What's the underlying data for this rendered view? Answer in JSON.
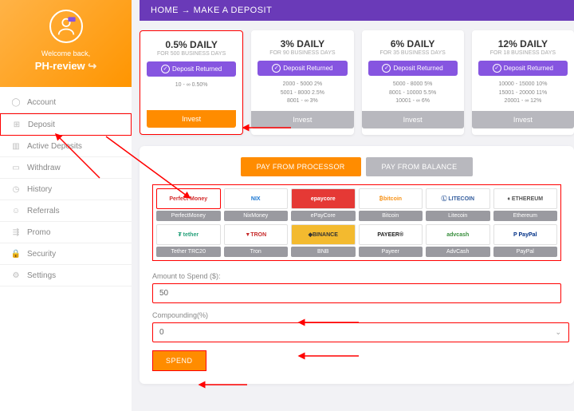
{
  "breadcrumb": {
    "home": "HOME",
    "sep": "→",
    "page": "MAKE A DEPOSIT"
  },
  "profile": {
    "welcome": "Welcome back,",
    "username": "PH-review"
  },
  "nav": [
    {
      "icon": "user-icon",
      "label": "Account"
    },
    {
      "icon": "plus-icon",
      "label": "Deposit"
    },
    {
      "icon": "bars-icon",
      "label": "Active Deposits"
    },
    {
      "icon": "card-icon",
      "label": "Withdraw"
    },
    {
      "icon": "clock-icon",
      "label": "History"
    },
    {
      "icon": "people-icon",
      "label": "Referrals"
    },
    {
      "icon": "share-icon",
      "label": "Promo"
    },
    {
      "icon": "lock-icon",
      "label": "Security"
    },
    {
      "icon": "sliders-icon",
      "label": "Settings"
    }
  ],
  "plans": [
    {
      "title": "0.5% DAILY",
      "sub": "FOR 500 BUSINESS DAYS",
      "badge": "Deposit Returned",
      "tiers": "10 - ∞ 0.50%",
      "btn": "Invest"
    },
    {
      "title": "3% DAILY",
      "sub": "FOR 90 BUSINESS DAYS",
      "badge": "Deposit Returned",
      "tiers": "2000 - 5000 2%\n5001 - 8000 2.5%\n8001 - ∞ 3%",
      "btn": "Invest"
    },
    {
      "title": "6% DAILY",
      "sub": "FOR 35 BUSINESS DAYS",
      "badge": "Deposit Returned",
      "tiers": "5000 - 8000 5%\n8001 - 10000 5.5%\n10001 - ∞ 6%",
      "btn": "Invest"
    },
    {
      "title": "12% DAILY",
      "sub": "FOR 18 BUSINESS DAYS",
      "badge": "Deposit Returned",
      "tiers": "10000 - 15000 10%\n15001 - 20000 11%\n20001 - ∞ 12%",
      "btn": "Invest"
    }
  ],
  "tabs": {
    "processor": "PAY FROM PROCESSOR",
    "balance": "PAY FROM BALANCE"
  },
  "processors": [
    [
      {
        "name": "PerfectMoney",
        "logo": "Perfect Money",
        "color": "#d32f2f"
      },
      {
        "name": "NixMoney",
        "logo": "NIX",
        "color": "#1976d2"
      },
      {
        "name": "ePayCore",
        "logo": "epaycore",
        "color": "#fff",
        "bg": "#e53935"
      },
      {
        "name": "Bitcoin",
        "logo": "₿bitcoin",
        "color": "#f7931a"
      },
      {
        "name": "Litecoin",
        "logo": "Ⓛ LITECOIN",
        "color": "#345d9d"
      },
      {
        "name": "Ethereum",
        "logo": "♦ ETHEREUM",
        "color": "#555"
      }
    ],
    [
      {
        "name": "Tether TRC20",
        "logo": "₮ tether",
        "color": "#26a17b"
      },
      {
        "name": "Tron",
        "logo": "▼TRON",
        "color": "#c62828"
      },
      {
        "name": "BNB",
        "logo": "◆BINANCE",
        "color": "#333",
        "bg": "#f3ba2f"
      },
      {
        "name": "Payeer",
        "logo": "PAYEER®",
        "color": "#222"
      },
      {
        "name": "AdvCash",
        "logo": "advcash",
        "color": "#388e3c"
      },
      {
        "name": "PayPal",
        "logo": "P PayPal",
        "color": "#003087"
      }
    ]
  ],
  "form": {
    "amount_label": "Amount to Spend ($):",
    "amount_value": "50",
    "compound_label": "Compounding(%)",
    "compound_value": "0",
    "submit": "SPEND"
  }
}
